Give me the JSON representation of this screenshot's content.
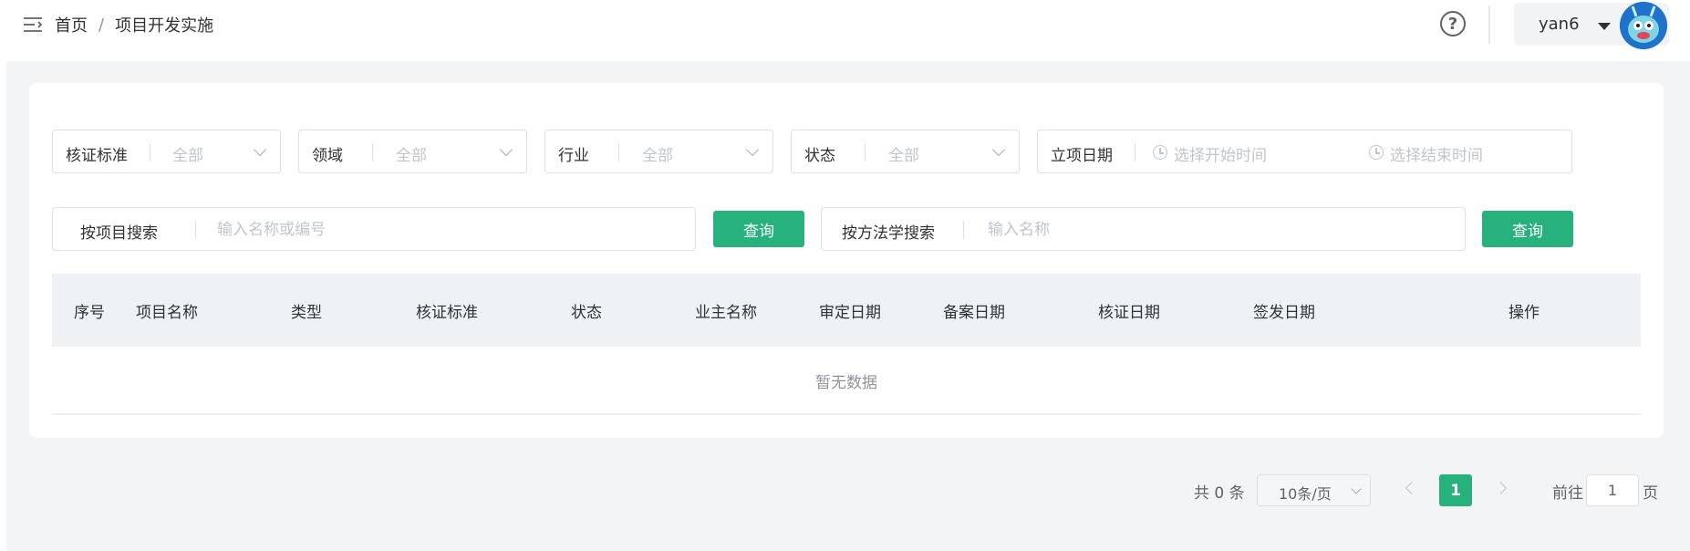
{
  "header": {
    "breadcrumb": {
      "home": "首页",
      "separator": "/",
      "current": "项目开发实施"
    },
    "user": {
      "name": "yan6"
    }
  },
  "filters": {
    "standard": {
      "label": "核证标准",
      "value": "全部"
    },
    "domain": {
      "label": "领域",
      "value": "全部"
    },
    "industry": {
      "label": "行业",
      "value": "全部"
    },
    "status": {
      "label": "状态",
      "value": "全部"
    },
    "date": {
      "label": "立项日期",
      "start_placeholder": "选择开始时间",
      "end_placeholder": "选择结束时间"
    }
  },
  "search": {
    "project": {
      "label": "按项目搜索",
      "placeholder": "输入名称或编号",
      "button": "查询"
    },
    "methodology": {
      "label": "按方法学搜索",
      "placeholder": "输入名称",
      "button": "查询"
    }
  },
  "table": {
    "columns": [
      "序号",
      "项目名称",
      "类型",
      "核证标准",
      "状态",
      "业主名称",
      "审定日期",
      "备案日期",
      "核证日期",
      "签发日期",
      "操作"
    ],
    "empty_text": "暂无数据"
  },
  "pagination": {
    "total": "共 0 条",
    "page_size": "10条/页",
    "current_page": "1",
    "goto_label": "前往",
    "goto_value": "1",
    "page_unit": "页"
  },
  "colors": {
    "accent": "#27b17c",
    "header_bg": "#eef2f5",
    "page_bg": "#f3f4f5"
  }
}
